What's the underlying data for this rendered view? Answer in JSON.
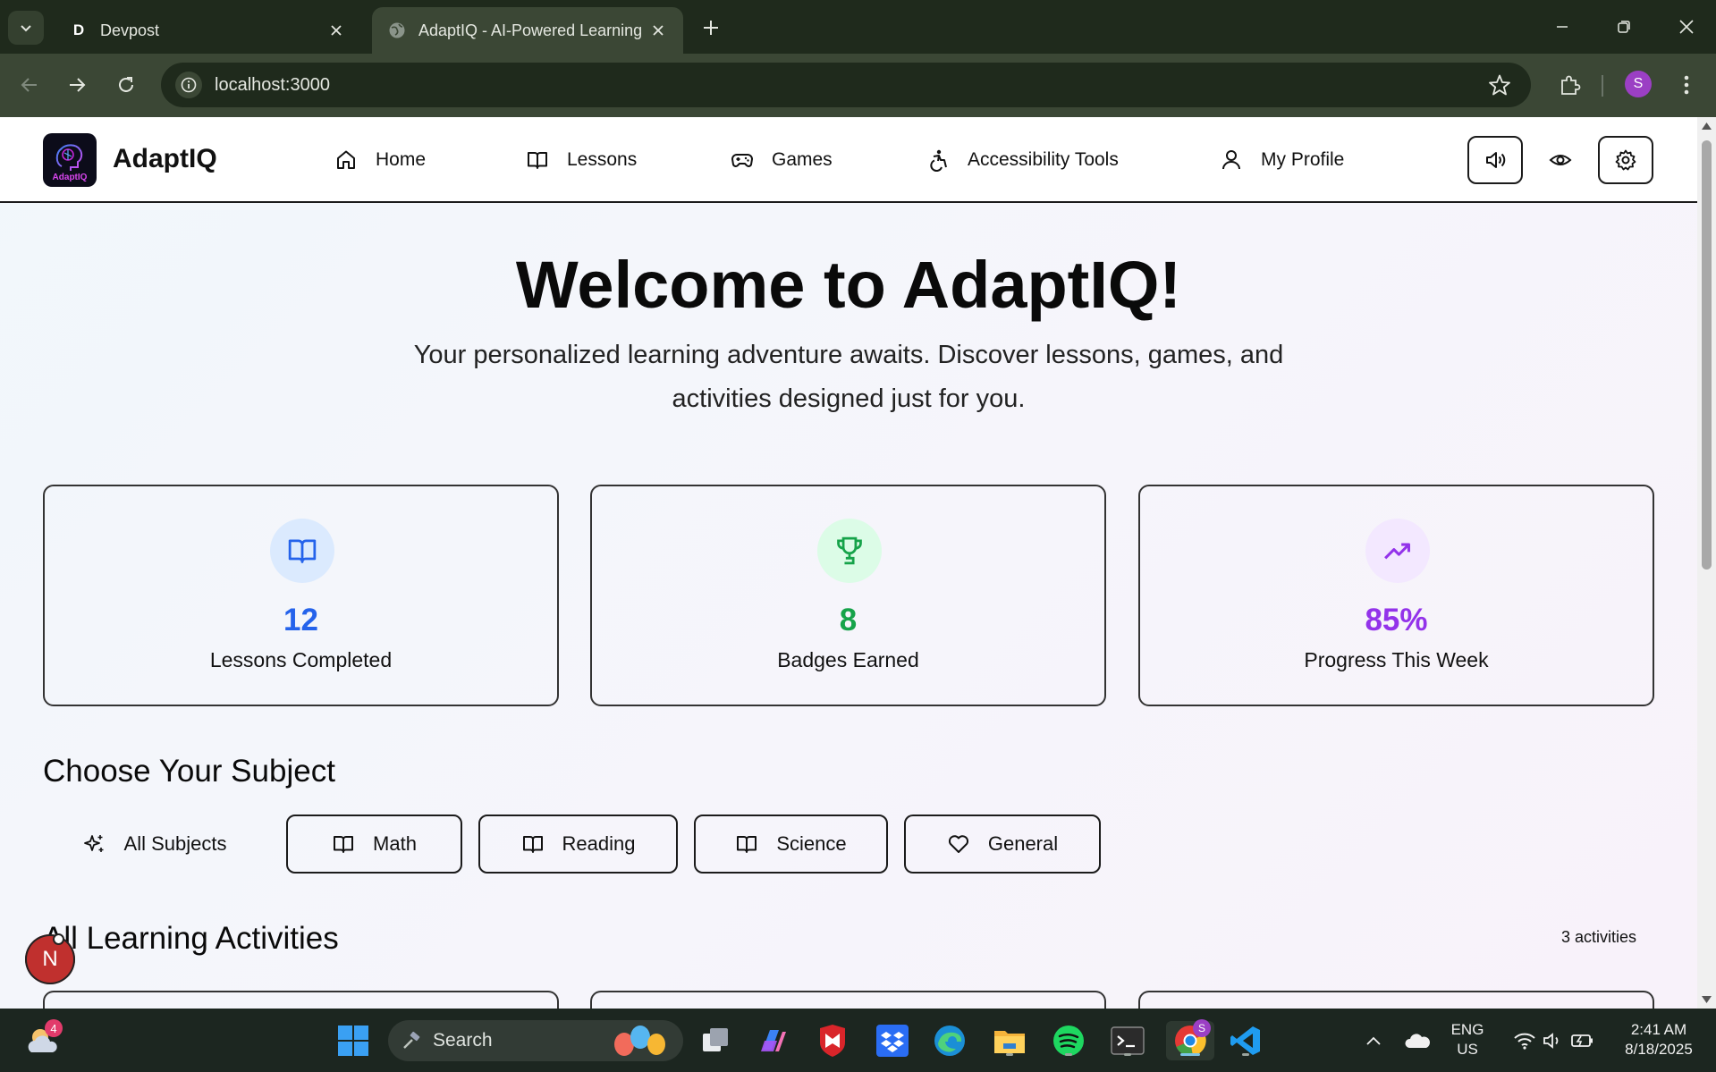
{
  "browser": {
    "tabs": [
      {
        "title": "Devpost",
        "favicon": "D"
      },
      {
        "title": "AdaptIQ - AI-Powered Learning"
      }
    ],
    "url": "localhost:3000",
    "profile_initial": "S"
  },
  "app": {
    "brand": "AdaptIQ",
    "logo_text": "AdaptIQ",
    "nav": [
      {
        "label": "Home",
        "icon": "home-icon"
      },
      {
        "label": "Lessons",
        "icon": "book-icon"
      },
      {
        "label": "Games",
        "icon": "gamepad-icon"
      },
      {
        "label": "Accessibility Tools",
        "icon": "accessibility-icon"
      },
      {
        "label": "My Profile",
        "icon": "user-icon"
      }
    ],
    "header_buttons": [
      "speaker-icon",
      "eye-icon",
      "gear-icon"
    ]
  },
  "hero": {
    "title": "Welcome to AdaptIQ!",
    "subtitle": "Your personalized learning adventure awaits. Discover lessons, games, and activities designed just for you."
  },
  "stats": [
    {
      "value": "12",
      "label": "Lessons Completed",
      "color": "#2563eb",
      "bg": "#dbeafe",
      "icon": "book-icon"
    },
    {
      "value": "8",
      "label": "Badges Earned",
      "color": "#16a34a",
      "bg": "#dcfce7",
      "icon": "trophy-icon"
    },
    {
      "value": "85%",
      "label": "Progress This Week",
      "color": "#9333ea",
      "bg": "#f3e8ff",
      "icon": "trending-up-icon"
    }
  ],
  "subjects": {
    "title": "Choose Your Subject",
    "items": [
      {
        "label": "All Subjects",
        "icon": "sparkles-icon",
        "selected": true
      },
      {
        "label": "Math",
        "icon": "book-icon"
      },
      {
        "label": "Reading",
        "icon": "book-icon"
      },
      {
        "label": "Science",
        "icon": "book-icon"
      },
      {
        "label": "General",
        "icon": "heart-icon"
      }
    ]
  },
  "activities": {
    "title": "All Learning Activities",
    "count": "3 activities"
  },
  "notifications": {
    "initial": "N"
  },
  "taskbar": {
    "search_label": "Search",
    "weather_badge": "4",
    "language": "ENG",
    "region": "US",
    "time": "2:41 AM",
    "date": "8/18/2025"
  }
}
